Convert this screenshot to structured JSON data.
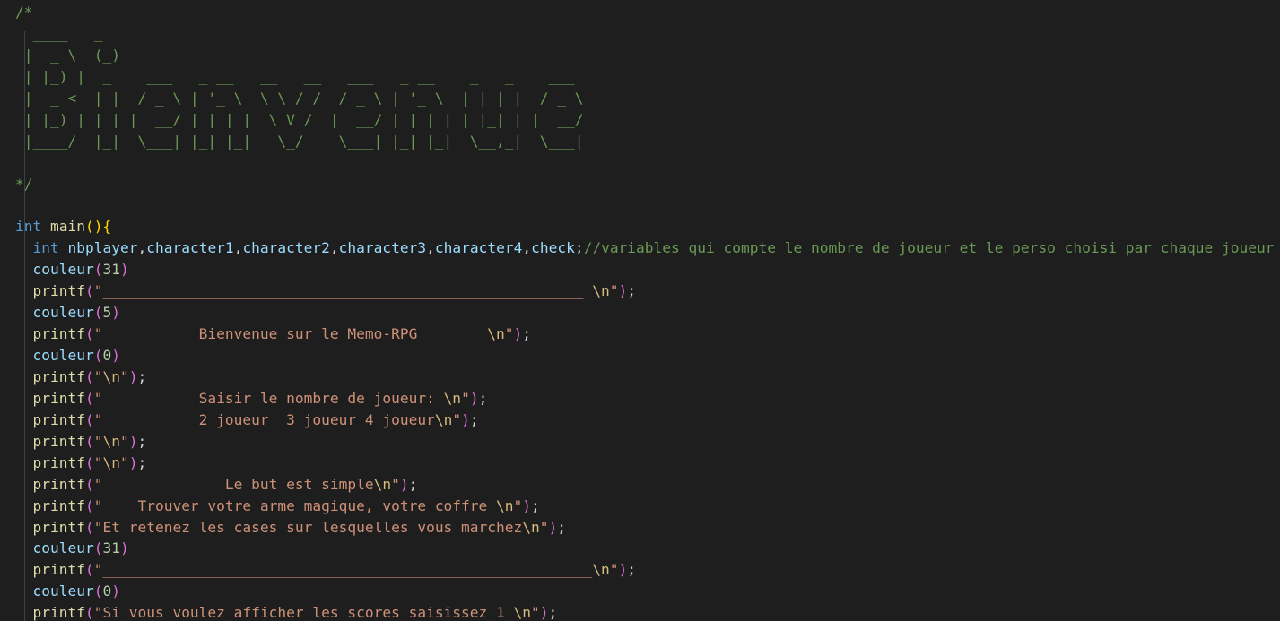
{
  "editor": {
    "lines": [
      [
        {
          "t": "/*",
          "c": "cmt"
        }
      ],
      [
        {
          "t": "  ____   _",
          "c": "cmt"
        }
      ],
      [
        {
          "t": " |  _ \\  (_)",
          "c": "cmt"
        }
      ],
      [
        {
          "t": " | |_) |  _    ___   _ __   __   __   ___   _ __    _   _    ___",
          "c": "cmt"
        }
      ],
      [
        {
          "t": " |  _ <  | |  / _ \\ | '_ \\  \\ \\ / /  / _ \\ | '_ \\  | | | |  / _ \\",
          "c": "cmt"
        }
      ],
      [
        {
          "t": " | |_) | | | |  __/ | | | |  \\ V /  |  __/ | | | | | |_| | |  __/",
          "c": "cmt"
        }
      ],
      [
        {
          "t": " |____/  |_|  \\___| |_| |_|   \\_/    \\___| |_| |_|  \\__,_|  \\___|",
          "c": "cmt"
        }
      ],
      [
        {
          "t": "",
          "c": "pl"
        }
      ],
      [
        {
          "t": "*/",
          "c": "cmt"
        }
      ],
      [
        {
          "t": "",
          "c": "pl"
        }
      ],
      [
        {
          "t": "int",
          "c": "kw"
        },
        {
          "t": " ",
          "c": "pl"
        },
        {
          "t": "main",
          "c": "fn"
        },
        {
          "t": "()",
          "c": "p1"
        },
        {
          "t": "{",
          "c": "p1"
        }
      ],
      [
        {
          "t": "  ",
          "c": "pl"
        },
        {
          "t": "int",
          "c": "kw"
        },
        {
          "t": " ",
          "c": "pl"
        },
        {
          "t": "nbplayer",
          "c": "var"
        },
        {
          "t": ",",
          "c": "pl"
        },
        {
          "t": "character1",
          "c": "var"
        },
        {
          "t": ",",
          "c": "pl"
        },
        {
          "t": "character2",
          "c": "var"
        },
        {
          "t": ",",
          "c": "pl"
        },
        {
          "t": "character3",
          "c": "var"
        },
        {
          "t": ",",
          "c": "pl"
        },
        {
          "t": "character4",
          "c": "var"
        },
        {
          "t": ",",
          "c": "pl"
        },
        {
          "t": "check",
          "c": "var"
        },
        {
          "t": ";",
          "c": "pl"
        },
        {
          "t": "//variables qui compte le nombre de joueur et le perso choisi par chaque joueur",
          "c": "cmt"
        }
      ],
      [
        {
          "t": "  ",
          "c": "pl"
        },
        {
          "t": "couleur",
          "c": "var"
        },
        {
          "t": "(",
          "c": "p2"
        },
        {
          "t": "31",
          "c": "num"
        },
        {
          "t": ")",
          "c": "p2"
        }
      ],
      [
        {
          "t": "  ",
          "c": "pl"
        },
        {
          "t": "printf",
          "c": "fn"
        },
        {
          "t": "(",
          "c": "p2"
        },
        {
          "t": "\"_______________________________________________________ ",
          "c": "str"
        },
        {
          "t": "\\n",
          "c": "esc"
        },
        {
          "t": "\"",
          "c": "str"
        },
        {
          "t": ")",
          "c": "p2"
        },
        {
          "t": ";",
          "c": "pl"
        }
      ],
      [
        {
          "t": "  ",
          "c": "pl"
        },
        {
          "t": "couleur",
          "c": "var"
        },
        {
          "t": "(",
          "c": "p2"
        },
        {
          "t": "5",
          "c": "num"
        },
        {
          "t": ")",
          "c": "p2"
        }
      ],
      [
        {
          "t": "  ",
          "c": "pl"
        },
        {
          "t": "printf",
          "c": "fn"
        },
        {
          "t": "(",
          "c": "p2"
        },
        {
          "t": "\"           Bienvenue sur le Memo-RPG        ",
          "c": "str"
        },
        {
          "t": "\\n",
          "c": "esc"
        },
        {
          "t": "\"",
          "c": "str"
        },
        {
          "t": ")",
          "c": "p2"
        },
        {
          "t": ";",
          "c": "pl"
        }
      ],
      [
        {
          "t": "  ",
          "c": "pl"
        },
        {
          "t": "couleur",
          "c": "var"
        },
        {
          "t": "(",
          "c": "p2"
        },
        {
          "t": "0",
          "c": "num"
        },
        {
          "t": ")",
          "c": "p2"
        }
      ],
      [
        {
          "t": "  ",
          "c": "pl"
        },
        {
          "t": "printf",
          "c": "fn"
        },
        {
          "t": "(",
          "c": "p2"
        },
        {
          "t": "\"",
          "c": "str"
        },
        {
          "t": "\\n",
          "c": "esc"
        },
        {
          "t": "\"",
          "c": "str"
        },
        {
          "t": ")",
          "c": "p2"
        },
        {
          "t": ";",
          "c": "pl"
        }
      ],
      [
        {
          "t": "  ",
          "c": "pl"
        },
        {
          "t": "printf",
          "c": "fn"
        },
        {
          "t": "(",
          "c": "p2"
        },
        {
          "t": "\"           Saisir le nombre de joueur: ",
          "c": "str"
        },
        {
          "t": "\\n",
          "c": "esc"
        },
        {
          "t": "\"",
          "c": "str"
        },
        {
          "t": ")",
          "c": "p2"
        },
        {
          "t": ";",
          "c": "pl"
        }
      ],
      [
        {
          "t": "  ",
          "c": "pl"
        },
        {
          "t": "printf",
          "c": "fn"
        },
        {
          "t": "(",
          "c": "p2"
        },
        {
          "t": "\"           2 joueur  3 joueur 4 joueur",
          "c": "str"
        },
        {
          "t": "\\n",
          "c": "esc"
        },
        {
          "t": "\"",
          "c": "str"
        },
        {
          "t": ")",
          "c": "p2"
        },
        {
          "t": ";",
          "c": "pl"
        }
      ],
      [
        {
          "t": "  ",
          "c": "pl"
        },
        {
          "t": "printf",
          "c": "fn"
        },
        {
          "t": "(",
          "c": "p2"
        },
        {
          "t": "\"",
          "c": "str"
        },
        {
          "t": "\\n",
          "c": "esc"
        },
        {
          "t": "\"",
          "c": "str"
        },
        {
          "t": ")",
          "c": "p2"
        },
        {
          "t": ";",
          "c": "pl"
        }
      ],
      [
        {
          "t": "  ",
          "c": "pl"
        },
        {
          "t": "printf",
          "c": "fn"
        },
        {
          "t": "(",
          "c": "p2"
        },
        {
          "t": "\"",
          "c": "str"
        },
        {
          "t": "\\n",
          "c": "esc"
        },
        {
          "t": "\"",
          "c": "str"
        },
        {
          "t": ")",
          "c": "p2"
        },
        {
          "t": ";",
          "c": "pl"
        }
      ],
      [
        {
          "t": "  ",
          "c": "pl"
        },
        {
          "t": "printf",
          "c": "fn"
        },
        {
          "t": "(",
          "c": "p2"
        },
        {
          "t": "\"              Le but est simple",
          "c": "str"
        },
        {
          "t": "\\n",
          "c": "esc"
        },
        {
          "t": "\"",
          "c": "str"
        },
        {
          "t": ")",
          "c": "p2"
        },
        {
          "t": ";",
          "c": "pl"
        }
      ],
      [
        {
          "t": "  ",
          "c": "pl"
        },
        {
          "t": "printf",
          "c": "fn"
        },
        {
          "t": "(",
          "c": "p2"
        },
        {
          "t": "\"    Trouver votre arme magique, votre coffre ",
          "c": "str"
        },
        {
          "t": "\\n",
          "c": "esc"
        },
        {
          "t": "\"",
          "c": "str"
        },
        {
          "t": ")",
          "c": "p2"
        },
        {
          "t": ";",
          "c": "pl"
        }
      ],
      [
        {
          "t": "  ",
          "c": "pl"
        },
        {
          "t": "printf",
          "c": "fn"
        },
        {
          "t": "(",
          "c": "p2"
        },
        {
          "t": "\"Et retenez les cases sur lesquelles vous marchez",
          "c": "str"
        },
        {
          "t": "\\n",
          "c": "esc"
        },
        {
          "t": "\"",
          "c": "str"
        },
        {
          "t": ")",
          "c": "p2"
        },
        {
          "t": ";",
          "c": "pl"
        }
      ],
      [
        {
          "t": "  ",
          "c": "pl"
        },
        {
          "t": "couleur",
          "c": "var"
        },
        {
          "t": "(",
          "c": "p2"
        },
        {
          "t": "31",
          "c": "num"
        },
        {
          "t": ")",
          "c": "p2"
        }
      ],
      [
        {
          "t": "  ",
          "c": "pl"
        },
        {
          "t": "printf",
          "c": "fn"
        },
        {
          "t": "(",
          "c": "p2"
        },
        {
          "t": "\"________________________________________________________",
          "c": "str"
        },
        {
          "t": "\\n",
          "c": "esc"
        },
        {
          "t": "\"",
          "c": "str"
        },
        {
          "t": ")",
          "c": "p2"
        },
        {
          "t": ";",
          "c": "pl"
        }
      ],
      [
        {
          "t": "  ",
          "c": "pl"
        },
        {
          "t": "couleur",
          "c": "var"
        },
        {
          "t": "(",
          "c": "p2"
        },
        {
          "t": "0",
          "c": "num"
        },
        {
          "t": ")",
          "c": "p2"
        }
      ],
      [
        {
          "t": "  ",
          "c": "pl"
        },
        {
          "t": "printf",
          "c": "fn"
        },
        {
          "t": "(",
          "c": "p2"
        },
        {
          "t": "\"Si vous voulez afficher les scores saisissez 1 ",
          "c": "str"
        },
        {
          "t": "\\n",
          "c": "esc"
        },
        {
          "t": "\"",
          "c": "str"
        },
        {
          "t": ")",
          "c": "p2"
        },
        {
          "t": ";",
          "c": "pl"
        }
      ]
    ]
  }
}
